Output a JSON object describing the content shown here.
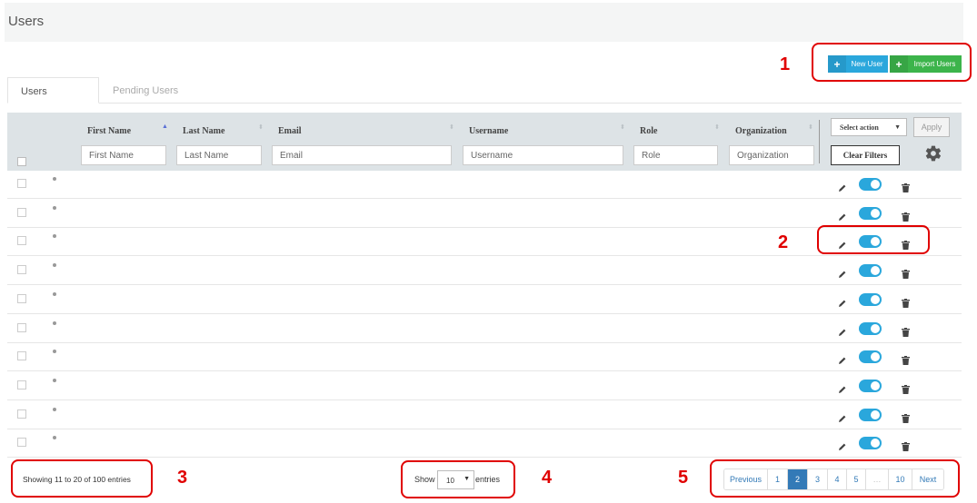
{
  "header": {
    "title": "Users"
  },
  "actions": {
    "new_user": "New User",
    "import_users": "Import Users",
    "plus": "+"
  },
  "tabs": [
    {
      "label": "Users",
      "active": true
    },
    {
      "label": "Pending Users",
      "active": false
    }
  ],
  "table": {
    "columns": [
      {
        "label": "First Name",
        "placeholder": "First Name"
      },
      {
        "label": "Last Name",
        "placeholder": "Last Name"
      },
      {
        "label": "Email",
        "placeholder": "Email"
      },
      {
        "label": "Username",
        "placeholder": "Username"
      },
      {
        "label": "Role",
        "placeholder": "Role"
      },
      {
        "label": "Organization",
        "placeholder": "Organization"
      }
    ],
    "select_action": "Select action",
    "apply": "Apply",
    "clear_filters": "Clear Filters",
    "row_count": 10,
    "toggle_color": "#2aa7dc"
  },
  "footer": {
    "showing": "Showing 11 to 20 of 100 entries",
    "show_label": "Show",
    "page_size": "10",
    "entries_label": "entries",
    "pagination": [
      {
        "label": "Previous",
        "active": false
      },
      {
        "label": "1",
        "active": false
      },
      {
        "label": "2",
        "active": true
      },
      {
        "label": "3",
        "active": false
      },
      {
        "label": "4",
        "active": false
      },
      {
        "label": "5",
        "active": false
      },
      {
        "label": "…",
        "active": false
      },
      {
        "label": "10",
        "active": false
      },
      {
        "label": "Next",
        "active": false
      }
    ]
  },
  "annotations": [
    "1",
    "2",
    "3",
    "4",
    "5"
  ],
  "colors": {
    "annotation": "#e00000",
    "new_user_button": "#2aa7dc",
    "import_button": "#3cb44b",
    "active_page": "#337ab7"
  }
}
